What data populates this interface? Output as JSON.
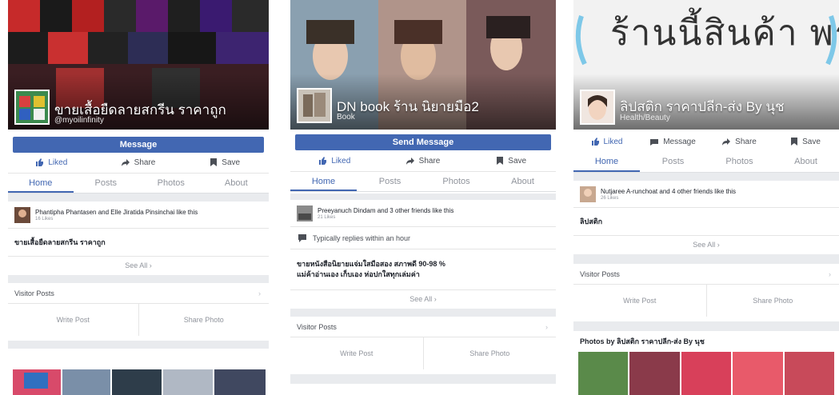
{
  "panels": [
    {
      "name": "ขายเสื้อยืดลายสกรีน ราคาถูก",
      "subtitle": "@myoilinfinity",
      "message_label": "Message",
      "actions": [
        {
          "label": "Liked",
          "icon": "thumbs-up-icon"
        },
        {
          "label": "Share",
          "icon": "share-icon"
        },
        {
          "label": "Save",
          "icon": "bookmark-icon"
        }
      ],
      "tabs": [
        "Home",
        "Posts",
        "Photos",
        "About"
      ],
      "active_tab": "Home",
      "likers": "Phantipha Phantasen and Elle Jiratida Pinsinchai like this",
      "likes_count": "16 Likes",
      "description": "ขายเสื้อยืดลายสกรีน ราคาถูก",
      "see_all": "See All",
      "visitor_posts": "Visitor Posts",
      "write_post": "Write Post",
      "share_photo": "Share Photo"
    },
    {
      "name": "DN book ร้าน นิยายมือ2",
      "subtitle": "Book",
      "message_label": "Send Message",
      "actions": [
        {
          "label": "Liked",
          "icon": "thumbs-up-icon"
        },
        {
          "label": "Share",
          "icon": "share-icon"
        },
        {
          "label": "Save",
          "icon": "bookmark-icon"
        }
      ],
      "tabs": [
        "Home",
        "Posts",
        "Photos",
        "About"
      ],
      "active_tab": "Home",
      "likers": "Preeyanuch Dindam and 3 other friends like this",
      "likes_count": "21 Likes",
      "replies": "Typically replies within an hour",
      "description_lines": [
        "ขายหนังสือนิยายแจ่มใสมือสอง สภาพดี 90-98 %",
        "แม่ค้าอ่านเอง เก็บเอง ห่อปกใสทุกเล่มค่า"
      ],
      "see_all": "See All",
      "visitor_posts": "Visitor Posts",
      "write_post": "Write Post",
      "share_photo": "Share Photo"
    },
    {
      "name": "ลิปสติก ราคาปลีก-ส่ง By นุช",
      "subtitle": "Health/Beauty",
      "cover_text": "ร้านนี้สินค้า พร้อมส่ง",
      "actions": [
        {
          "label": "Liked",
          "icon": "thumbs-up-icon"
        },
        {
          "label": "Message",
          "icon": "messenger-icon"
        },
        {
          "label": "Share",
          "icon": "share-icon"
        },
        {
          "label": "Save",
          "icon": "bookmark-icon"
        }
      ],
      "tabs": [
        "Home",
        "Posts",
        "Photos",
        "About"
      ],
      "active_tab": "Home",
      "likers": "Nutjaree A-runchoat and 4 other friends like this",
      "likes_count": "26 Likes",
      "description": "ลิปสติก",
      "see_all": "See All",
      "visitor_posts": "Visitor Posts",
      "write_post": "Write Post",
      "share_photo": "Share Photo",
      "photos_by": "Photos by ลิปสติก ราคาปลีก-ส่ง By นุช"
    }
  ],
  "colors": {
    "facebook_blue": "#4267b2",
    "background": "#e9ebee",
    "muted_text": "#90949c"
  }
}
